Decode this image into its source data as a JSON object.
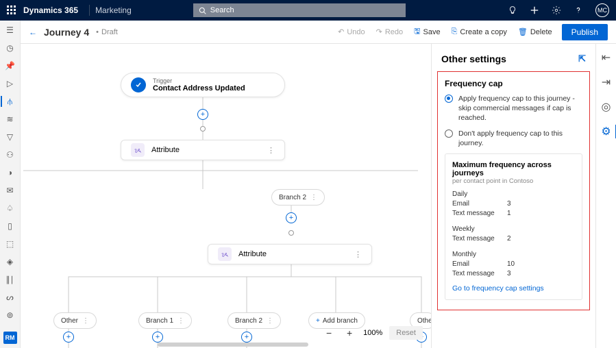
{
  "top": {
    "brand": "Dynamics 365",
    "area": "Marketing",
    "search_placeholder": "Search",
    "avatar": "MC"
  },
  "header": {
    "title": "Journey 4",
    "status": "Draft",
    "undo": "Undo",
    "redo": "Redo",
    "save": "Save",
    "copy": "Create a copy",
    "delete": "Delete",
    "publish": "Publish"
  },
  "canvas": {
    "trigger_label": "Trigger",
    "trigger_name": "Contact Address Updated",
    "attribute": "Attribute",
    "branch2": "Branch 2",
    "branch1": "Branch 1",
    "other": "Other",
    "add_branch": "Add branch",
    "zoom": "100%",
    "reset": "Reset"
  },
  "panel": {
    "title": "Other settings",
    "section": "Frequency cap",
    "opt1": "Apply frequency cap to this journey - skip commercial messages if cap is reached.",
    "opt2": "Don't apply frequency cap to this journey.",
    "card_title": "Maximum frequency across journeys",
    "card_sub": "per contact point in Contoso",
    "daily": "Daily",
    "weekly": "Weekly",
    "monthly": "Monthly",
    "email": "Email",
    "text": "Text message",
    "d_email": "3",
    "d_text": "1",
    "w_text": "2",
    "m_email": "10",
    "m_text": "3",
    "link": "Go to frequency cap settings"
  }
}
